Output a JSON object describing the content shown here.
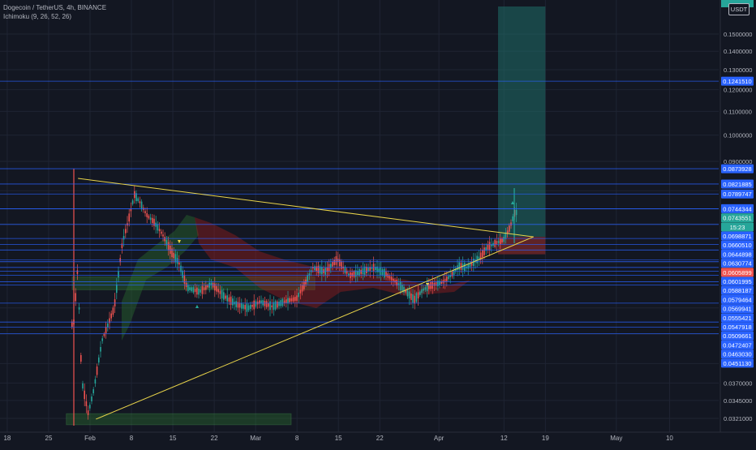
{
  "header": {
    "title": "Dogecoin / TetherUS, 4h, BINANCE",
    "indicator": "Ichimoku (9, 26, 52, 26)"
  },
  "currency_badge": "USDT",
  "colors": {
    "background": "#131722",
    "grid": "#1f2433",
    "candle_up": "#26a69a",
    "candle_down": "#ef5350",
    "level_line": "#2962ff",
    "label_blue": "#2962ff",
    "label_red": "#ef5350",
    "label_green": "#26a69a",
    "triangle": "#e9d44a",
    "cloud_green": "#2e7d32",
    "cloud_red": "#b71c1c",
    "target_zone": "#1f6e67",
    "stop_zone": "#7f2a2a"
  },
  "chart_data": {
    "type": "candlestick",
    "symbol": "DOGE/USDT",
    "timeframe": "4h",
    "exchange": "BINANCE",
    "ylim": [
      0.0309,
      0.16
    ],
    "scale": "log",
    "grid": true,
    "price_axis_ticks": [
      "0.1500000",
      "0.1400000",
      "0.1300000",
      "0.1200000",
      "0.1100000",
      "0.1000000",
      "0.0900000",
      "0.0370000",
      "0.0345000",
      "0.0321000"
    ],
    "time_axis_ticks": [
      "18",
      "25",
      "Feb",
      "8",
      "15",
      "22",
      "Mar",
      "8",
      "15",
      "22",
      "Apr",
      "12",
      "19",
      "May",
      "10"
    ],
    "price_levels": [
      {
        "label": "0.1241510",
        "value": 0.124151,
        "style": "blue"
      },
      {
        "label": "0.0873928",
        "value": 0.0873928,
        "style": "blue"
      },
      {
        "label": "0.0821885",
        "value": 0.0821885,
        "style": "blue"
      },
      {
        "label": "0.0789747",
        "value": 0.0789747,
        "style": "blue"
      },
      {
        "label": "0.0744344",
        "value": 0.0744344,
        "style": "blue"
      },
      {
        "label": "0.0743551",
        "value": 0.0743551,
        "style": "green"
      },
      {
        "label": "15:23",
        "value": 0.0718,
        "style": "green_small"
      },
      {
        "label": "0.0698871",
        "value": 0.0698871,
        "style": "blue"
      },
      {
        "label": "0.0660510",
        "value": 0.066051,
        "style": "blue"
      },
      {
        "label": "0.0644898",
        "value": 0.0644898,
        "style": "blue"
      },
      {
        "label": "0.0630774",
        "value": 0.0630774,
        "style": "blue"
      },
      {
        "label": "0.0605899",
        "value": 0.0605899,
        "style": "red"
      },
      {
        "label": "0.0601995",
        "value": 0.0601995,
        "style": "blue"
      },
      {
        "label": "0.0588187",
        "value": 0.0588187,
        "style": "blue"
      },
      {
        "label": "0.0579464",
        "value": 0.0579464,
        "style": "blue"
      },
      {
        "label": "0.0569941",
        "value": 0.0569941,
        "style": "blue"
      },
      {
        "label": "0.0555421",
        "value": 0.0555421,
        "style": "blue"
      },
      {
        "label": "0.0547918",
        "value": 0.0547918,
        "style": "blue"
      },
      {
        "label": "0.0509661",
        "value": 0.0509661,
        "style": "blue"
      },
      {
        "label": "0.0472407",
        "value": 0.0472407,
        "style": "blue"
      },
      {
        "label": "0.0463030",
        "value": 0.046303,
        "style": "blue"
      },
      {
        "label": "0.0451130",
        "value": 0.045113,
        "style": "blue"
      }
    ],
    "triangle": {
      "upper": [
        [
          "Jan 29",
          0.0835
        ],
        [
          "Apr 17",
          0.0665
        ]
      ],
      "lower": [
        [
          "Feb 2",
          0.032
        ],
        [
          "Apr 17",
          0.0665
        ]
      ]
    },
    "position_zones": {
      "target": {
        "from": 0.0665,
        "to": 0.16,
        "start": "Apr 11",
        "end": "Apr 19"
      },
      "stop": {
        "from": 0.0665,
        "to": 0.062,
        "start": "Apr 11",
        "end": "Apr 19"
      }
    },
    "support_boxes": [
      {
        "from": 0.0538,
        "to": 0.0566,
        "start": "Jan 29",
        "end": "Mar 11"
      },
      {
        "from": 0.0313,
        "to": 0.0327,
        "start": "Jan 28",
        "end": "Mar 7"
      }
    ]
  }
}
